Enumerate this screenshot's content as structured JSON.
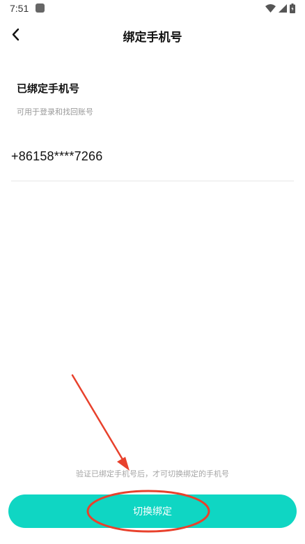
{
  "status_bar": {
    "time": "7:51",
    "icons": [
      "app-notification-icon",
      "wifi-icon",
      "signal-icon",
      "battery-icon"
    ]
  },
  "header": {
    "title": "绑定手机号",
    "back_icon": "chevron-left-icon"
  },
  "bound_phone": {
    "title": "已绑定手机号",
    "subtitle": "可用于登录和找回账号",
    "phone_number": "+86158****7266"
  },
  "footer": {
    "hint": "验证已绑定手机号后，才可切换绑定的手机号",
    "button_label": "切换绑定"
  },
  "colors": {
    "accent": "#0fd6c3",
    "annotation": "#e8412c"
  }
}
